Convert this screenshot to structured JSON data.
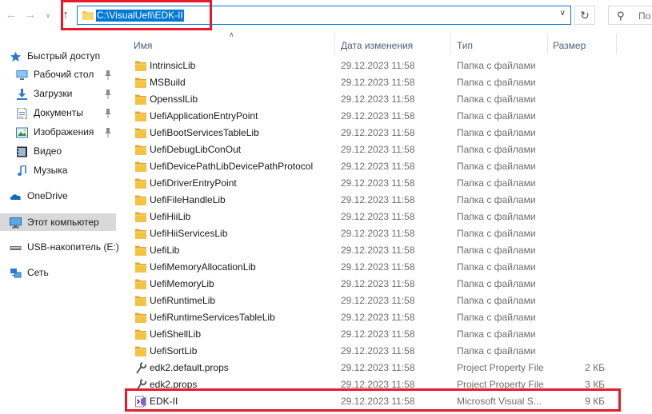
{
  "address_bar": {
    "path": "C:\\VisualUefi\\EDK-II",
    "search_placeholder": "По"
  },
  "icons": {
    "back": "arrow-left-icon",
    "forward": "arrow-right-icon",
    "recent": "chevron-down-icon",
    "up": "arrow-up-icon",
    "refresh": "refresh-icon",
    "search": "search-icon"
  },
  "colors": {
    "accent": "#0078d7",
    "highlight": "#e8192c",
    "folder": "#f5c342",
    "selected_nav": "#d9d9d9"
  },
  "sidebar": {
    "items": [
      {
        "label": "Быстрый доступ",
        "icon": "star-icon",
        "pinned": false
      },
      {
        "label": "Рабочий стол",
        "icon": "desktop-icon",
        "pinned": true
      },
      {
        "label": "Загрузки",
        "icon": "download-icon",
        "pinned": true
      },
      {
        "label": "Документы",
        "icon": "documents-icon",
        "pinned": true
      },
      {
        "label": "Изображения",
        "icon": "pictures-icon",
        "pinned": true
      },
      {
        "label": "Видео",
        "icon": "video-icon",
        "pinned": false
      },
      {
        "label": "Музыка",
        "icon": "music-icon",
        "pinned": false
      },
      {
        "label": "OneDrive",
        "icon": "cloud-icon",
        "pinned": false
      },
      {
        "label": "Этот компьютер",
        "icon": "computer-icon",
        "pinned": false,
        "selected": true
      },
      {
        "label": "USB-накопитель (E:)",
        "icon": "usb-drive-icon",
        "pinned": false
      },
      {
        "label": "Сеть",
        "icon": "network-icon",
        "pinned": false
      }
    ]
  },
  "columns": {
    "name": "Имя",
    "date": "Дата изменения",
    "type": "Тип",
    "size": "Размер"
  },
  "files": [
    {
      "name": "IntrinsicLib",
      "date": "29.12.2023 11:58",
      "type": "Папка с файлами",
      "size": "",
      "kind": "folder"
    },
    {
      "name": "MSBuild",
      "date": "29.12.2023 11:58",
      "type": "Папка с файлами",
      "size": "",
      "kind": "folder"
    },
    {
      "name": "OpensslLib",
      "date": "29.12.2023 11:58",
      "type": "Папка с файлами",
      "size": "",
      "kind": "folder"
    },
    {
      "name": "UefiApplicationEntryPoint",
      "date": "29.12.2023 11:58",
      "type": "Папка с файлами",
      "size": "",
      "kind": "folder"
    },
    {
      "name": "UefiBootServicesTableLib",
      "date": "29.12.2023 11:58",
      "type": "Папка с файлами",
      "size": "",
      "kind": "folder"
    },
    {
      "name": "UefiDebugLibConOut",
      "date": "29.12.2023 11:58",
      "type": "Папка с файлами",
      "size": "",
      "kind": "folder"
    },
    {
      "name": "UefiDevicePathLibDevicePathProtocol",
      "date": "29.12.2023 11:58",
      "type": "Папка с файлами",
      "size": "",
      "kind": "folder"
    },
    {
      "name": "UefiDriverEntryPoint",
      "date": "29.12.2023 11:58",
      "type": "Папка с файлами",
      "size": "",
      "kind": "folder"
    },
    {
      "name": "UefiFileHandleLib",
      "date": "29.12.2023 11:58",
      "type": "Папка с файлами",
      "size": "",
      "kind": "folder"
    },
    {
      "name": "UefiHiiLib",
      "date": "29.12.2023 11:58",
      "type": "Папка с файлами",
      "size": "",
      "kind": "folder"
    },
    {
      "name": "UefiHiiServicesLib",
      "date": "29.12.2023 11:58",
      "type": "Папка с файлами",
      "size": "",
      "kind": "folder"
    },
    {
      "name": "UefiLib",
      "date": "29.12.2023 11:58",
      "type": "Папка с файлами",
      "size": "",
      "kind": "folder"
    },
    {
      "name": "UefiMemoryAllocationLib",
      "date": "29.12.2023 11:58",
      "type": "Папка с файлами",
      "size": "",
      "kind": "folder"
    },
    {
      "name": "UefiMemoryLib",
      "date": "29.12.2023 11:58",
      "type": "Папка с файлами",
      "size": "",
      "kind": "folder"
    },
    {
      "name": "UefiRuntimeLib",
      "date": "29.12.2023 11:58",
      "type": "Папка с файлами",
      "size": "",
      "kind": "folder"
    },
    {
      "name": "UefiRuntimeServicesTableLib",
      "date": "29.12.2023 11:58",
      "type": "Папка с файлами",
      "size": "",
      "kind": "folder"
    },
    {
      "name": "UefiShellLib",
      "date": "29.12.2023 11:58",
      "type": "Папка с файлами",
      "size": "",
      "kind": "folder"
    },
    {
      "name": "UefiSortLib",
      "date": "29.12.2023 11:58",
      "type": "Папка с файлами",
      "size": "",
      "kind": "folder"
    },
    {
      "name": "edk2.default.props",
      "date": "29.12.2023 11:58",
      "type": "Project Property File",
      "size": "2 КБ",
      "kind": "props"
    },
    {
      "name": "edk2.props",
      "date": "29.12.2023 11:58",
      "type": "Project Property File",
      "size": "3 КБ",
      "kind": "props"
    },
    {
      "name": "EDK-II",
      "date": "29.12.2023 11:58",
      "type": "Microsoft Visual S...",
      "size": "9 КБ",
      "kind": "vs"
    }
  ]
}
